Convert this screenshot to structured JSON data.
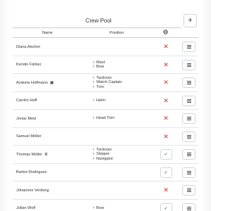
{
  "header": {
    "title": "Crew Pool",
    "add_label": "+"
  },
  "columns": {
    "name": "Name",
    "position": "Position",
    "flag_icon": "globe-icon"
  },
  "rows": [
    {
      "name": "Diana Alscher",
      "role_icon": "",
      "positions": [],
      "flag": "x"
    },
    {
      "name": "Kerstin Färber",
      "role_icon": "",
      "positions": [
        "Mast",
        "Bow"
      ],
      "flag": "x"
    },
    {
      "name": "Andoria Hoffmann",
      "role_icon": "id-badge-icon",
      "positions": [
        "Tactician",
        "Watch Captain",
        "Trim"
      ],
      "flag": "x"
    },
    {
      "name": "Carolin Huff",
      "role_icon": "",
      "positions": [
        "Helm"
      ],
      "flag": "x"
    },
    {
      "name": "Jonas Metz",
      "role_icon": "",
      "positions": [
        "Head Trim"
      ],
      "flag": "x"
    },
    {
      "name": "Samuel Möller",
      "role_icon": "",
      "positions": [],
      "flag": "x"
    },
    {
      "name": "Thomas Möller",
      "role_icon": "crown-icon",
      "positions": [
        "Tactician",
        "Skipper",
        "Navigator"
      ],
      "flag": "check"
    },
    {
      "name": "Barton Rodriguez",
      "role_icon": "",
      "positions": [],
      "flag": "check"
    },
    {
      "name": "Johannes Verdung",
      "role_icon": "",
      "positions": [],
      "flag": "x"
    },
    {
      "name": "Julian Wolf",
      "role_icon": "",
      "positions": [
        "Bow"
      ],
      "flag": "check"
    }
  ],
  "colors": {
    "x_mark": "#d62a2a",
    "border": "#cfd4da",
    "text": "#333333"
  }
}
